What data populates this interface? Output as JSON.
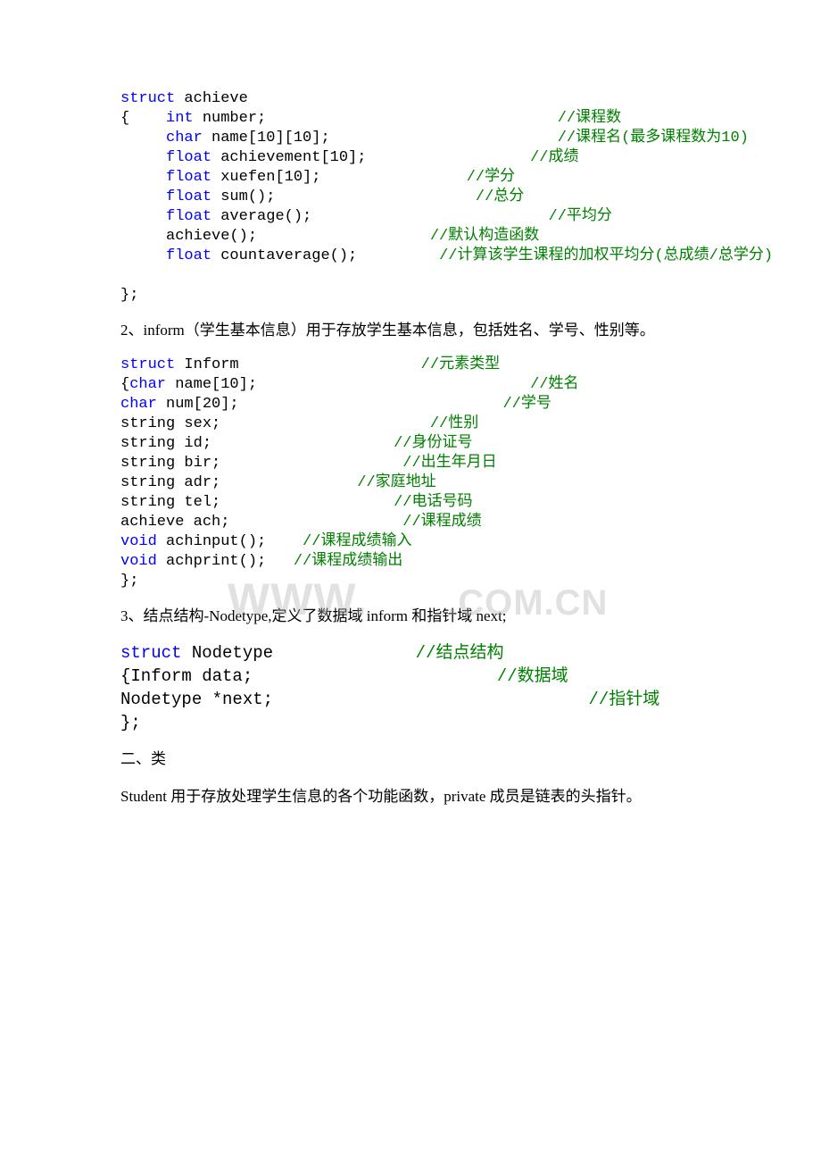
{
  "watermark": {
    "part1": "WWW.",
    "part2": ".COM.CN"
  },
  "code1": {
    "l1_a": "struct",
    "l1_b": " achieve",
    "l2_a": "{    ",
    "l2_b": "int",
    "l2_c": " number;                                ",
    "l2_d": "//课程数",
    "l3_a": "     ",
    "l3_b": "char",
    "l3_c": " name[10][10];                         ",
    "l3_d": "//课程名(最多课程数为10)",
    "l4_a": "     ",
    "l4_b": "float",
    "l4_c": " achievement[10];                  ",
    "l4_d": "//成绩",
    "l5_a": "     ",
    "l5_b": "float",
    "l5_c": " xuefen[10];                ",
    "l5_d": "//学分",
    "l6_a": "     ",
    "l6_b": "float",
    "l6_c": " sum();                      ",
    "l6_d": "//总分",
    "l7_a": "     ",
    "l7_b": "float",
    "l7_c": " average();                          ",
    "l7_d": "//平均分",
    "l8_a": "     achieve();                   ",
    "l8_b": "//默认构造函数",
    "l9_a": "     ",
    "l9_b": "float",
    "l9_c": " countaverage();         ",
    "l9_d": "//计算该学生课程的加权平均分(总成绩/总学分)",
    "l10": " ",
    "l11": "};"
  },
  "para2": "2、inform（学生基本信息）用于存放学生基本信息，包括姓名、学号、性别等。",
  "code2": {
    "l1_a": "struct",
    "l1_b": " Inform                    ",
    "l1_c": "//元素类型",
    "l2_a": "{",
    "l2_b": "char",
    "l2_c": " name[10];                              ",
    "l2_d": "//姓名",
    "l3_a": "char",
    "l3_b": " num[20];                             ",
    "l3_c": "//学号",
    "l4_a": "string sex;                       ",
    "l4_b": "//性别",
    "l5_a": "string id;                    ",
    "l5_b": "//身份证号",
    "l6_a": "string bir;                    ",
    "l6_b": "//出生年月日",
    "l7_a": "string adr;               ",
    "l7_b": "//家庭地址",
    "l8_a": "string tel;                   ",
    "l8_b": "//电话号码",
    "l9_a": "achieve ach;                   ",
    "l9_b": "//课程成绩",
    "l10_a": "void",
    "l10_b": " achinput();    ",
    "l10_c": "//课程成绩输入",
    "l11_a": "void",
    "l11_b": " achprint();   ",
    "l11_c": "//课程成绩输出",
    "l12": "};"
  },
  "para3": "3、结点结构-Nodetype,定义了数据域 inform 和指针域 next;",
  "code3": {
    "l1_a": "struct",
    "l1_b": " Nodetype              ",
    "l1_c": "//结点结构",
    "l2_a": "{Inform data;                        ",
    "l2_b": "//数据域",
    "l3_a": "Nodetype *next;                               ",
    "l3_b": "//指针域",
    "l4": "};"
  },
  "para4": "二、类",
  "para5": "Student  用于存放处理学生信息的各个功能函数，private 成员是链表的头指针。"
}
